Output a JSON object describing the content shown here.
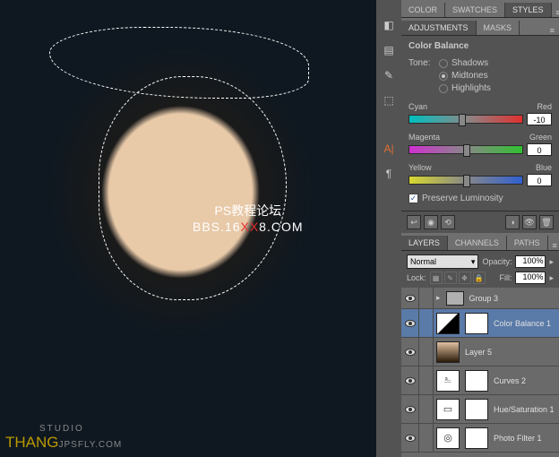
{
  "watermark": {
    "center_line1": "PS教程论坛",
    "center_prefix": "BBS.16",
    "center_red": "XX",
    "center_suffix": "8.COM",
    "bottom_studio": "STUDIO",
    "bottom_name": "THANG",
    "bottom_psfly": "JPSFLY.COM"
  },
  "top_tabs": {
    "color": "COLOR",
    "swatches": "SWATCHES",
    "styles": "STYLES"
  },
  "adj_tabs": {
    "adjustments": "ADJUSTMENTS",
    "masks": "MASKS"
  },
  "color_balance": {
    "title": "Color Balance",
    "tone_label": "Tone:",
    "shadows": "Shadows",
    "midtones": "Midtones",
    "highlights": "Highlights",
    "cyan": "Cyan",
    "red": "Red",
    "magenta": "Magenta",
    "green": "Green",
    "yellow": "Yellow",
    "blue": "Blue",
    "val_cr": "-10",
    "val_mg": "0",
    "val_yb": "0",
    "preserve": "Preserve Luminosity"
  },
  "layers_tabs": {
    "layers": "LAYERS",
    "channels": "CHANNELS",
    "paths": "PATHS"
  },
  "layers_controls": {
    "blend_mode": "Normal",
    "opacity_label": "Opacity:",
    "opacity_value": "100%",
    "lock_label": "Lock:",
    "fill_label": "Fill:",
    "fill_value": "100%"
  },
  "layers": {
    "group3": "Group 3",
    "colorbalance1": "Color Balance 1",
    "layer5": "Layer 5",
    "curves2": "Curves 2",
    "huesat1": "Hue/Saturation 1",
    "photofilter1": "Photo Filter 1"
  }
}
